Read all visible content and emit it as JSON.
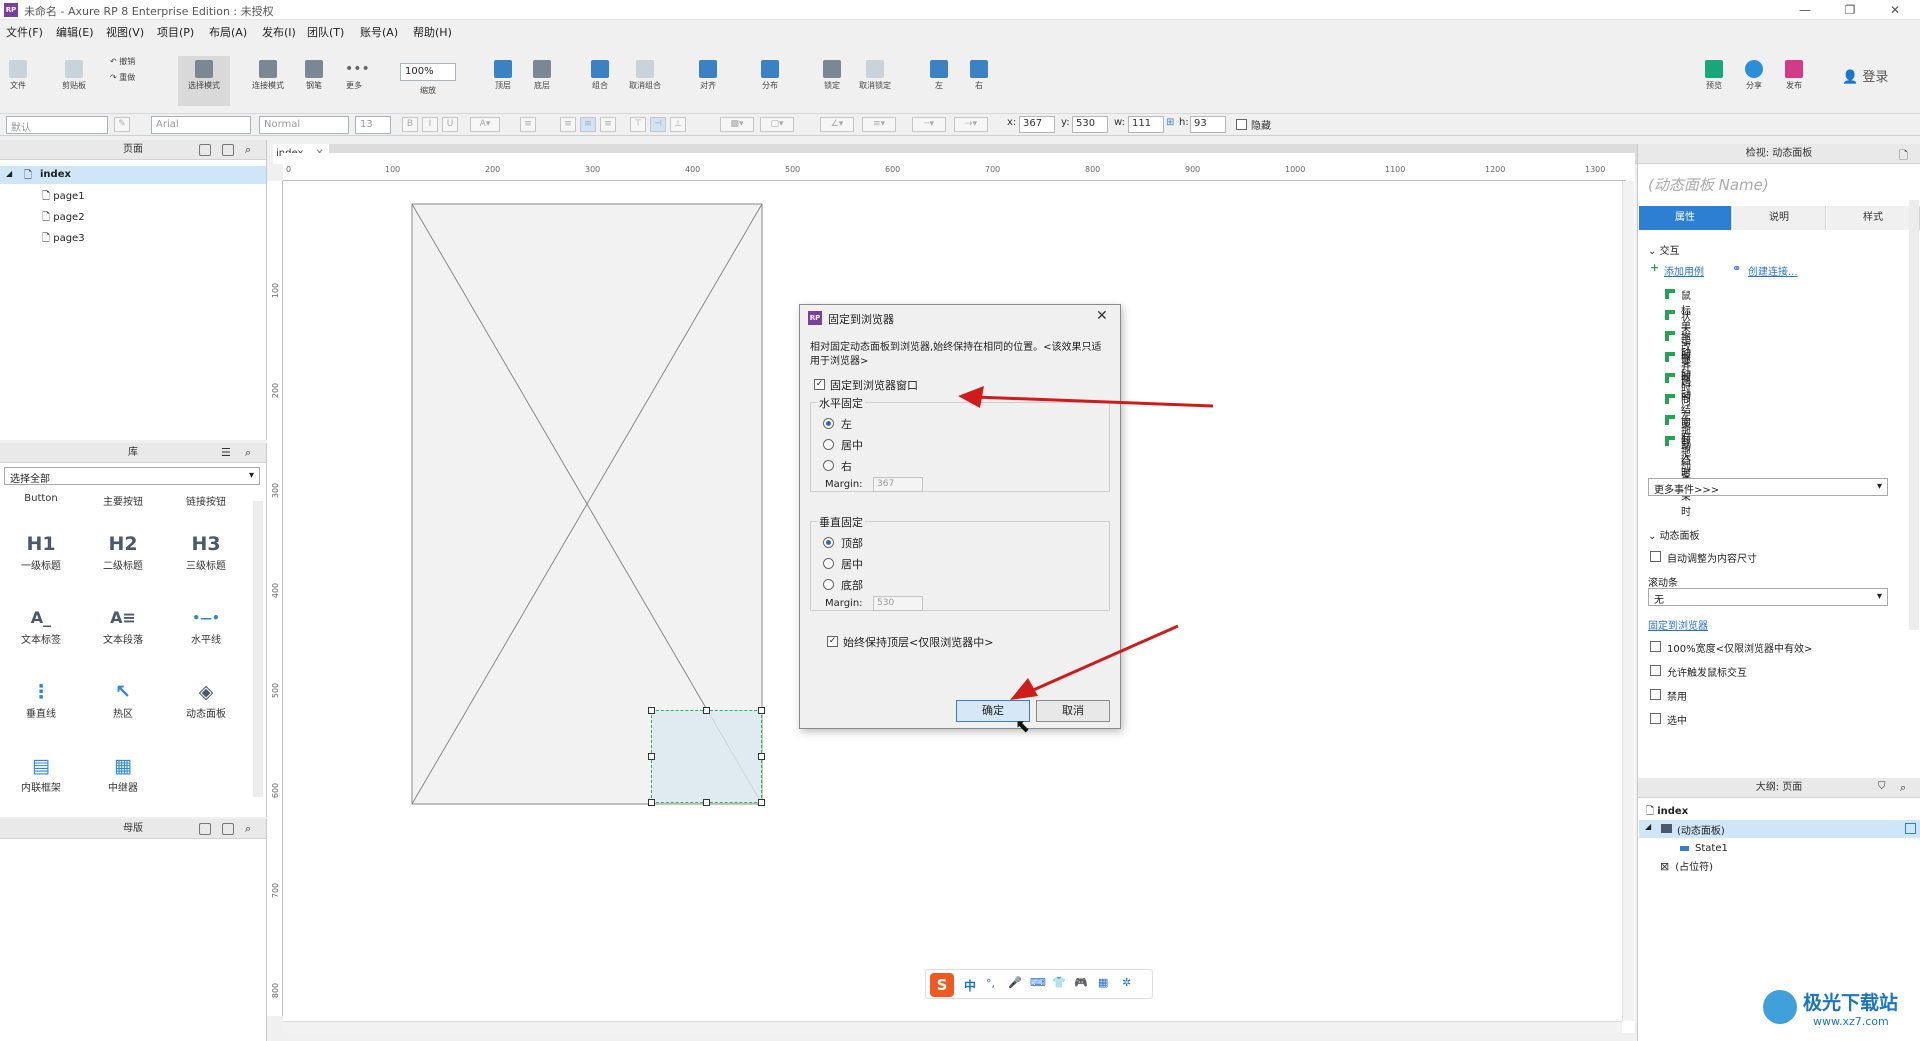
{
  "window": {
    "title": "未命名 - Axure RP 8 Enterprise Edition : 未授权",
    "logo_text": "RP",
    "controls": [
      "—",
      "❐",
      "✕"
    ]
  },
  "menu": [
    "文件(F)",
    "编辑(E)",
    "视图(V)",
    "项目(P)",
    "布局(A)",
    "发布(I)",
    "团队(T)",
    "账号(A)",
    "帮助(H)"
  ],
  "toolbar": {
    "file": "文件",
    "clipboard": "剪贴板",
    "undo": "撤销",
    "redo": "重做",
    "select_mode": "选择模式",
    "connect_mode": "连接模式",
    "pen": "钢笔",
    "more": "更多",
    "zoom_value": "100%",
    "zoom_label": "缩放",
    "top": "顶层",
    "bottom": "底层",
    "group": "组合",
    "ungroup": "取消组合",
    "align": "对齐",
    "distribute": "分布",
    "lock": "锁定",
    "unlock": "取消锁定",
    "left": "左",
    "right": "右",
    "preview": "预览",
    "share": "分享",
    "publish": "发布",
    "login": "登录"
  },
  "format_bar": {
    "style": "默认",
    "font": "Arial",
    "weight": "Normal",
    "size": "13",
    "x_label": "x:",
    "x": "367",
    "y_label": "y:",
    "y": "530",
    "w_label": "w:",
    "w": "111",
    "h_label": "h:",
    "h": "93",
    "hidden": "隐藏"
  },
  "pages_panel": {
    "title": "页面",
    "root": "index",
    "pages": [
      "page1",
      "page2",
      "page3"
    ]
  },
  "library_panel": {
    "title": "库",
    "filter": "选择全部",
    "row0": [
      "Button",
      "主要按钮",
      "链接按钮"
    ],
    "items": [
      {
        "glyph": "H1",
        "label": "一级标题"
      },
      {
        "glyph": "H2",
        "label": "二级标题"
      },
      {
        "glyph": "H3",
        "label": "三级标题"
      },
      {
        "glyph": "A_",
        "label": "文本标签"
      },
      {
        "glyph": "A≡",
        "label": "文本段落"
      },
      {
        "glyph": "•—•",
        "label": "水平线"
      },
      {
        "glyph": "⋮",
        "label": "垂直线"
      },
      {
        "glyph": "↖",
        "label": "热区"
      },
      {
        "glyph": "◈",
        "label": "动态面板"
      },
      {
        "glyph": "▤",
        "label": "内联框架"
      },
      {
        "glyph": "▦",
        "label": "中继器"
      }
    ]
  },
  "master_panel": {
    "title": "母版"
  },
  "canvas": {
    "tab": "index",
    "ruler_h": [
      "0",
      "100",
      "200",
      "300",
      "400",
      "500",
      "600",
      "700",
      "800",
      "900",
      "1000",
      "1100",
      "1200",
      "1300"
    ],
    "ruler_v": [
      "100",
      "200",
      "300",
      "400",
      "500",
      "600",
      "700",
      "800"
    ]
  },
  "dialog": {
    "title": "固定到浏览器",
    "logo": "RP",
    "description": "相对固定动态面板到浏览器,始终保持在相同的位置。<该效果只适用于浏览器>",
    "pin_checkbox": "固定到浏览器窗口",
    "pin_checked": true,
    "horizontal": {
      "legend": "水平固定",
      "options": [
        "左",
        "居中",
        "右"
      ],
      "selected": "左",
      "margin_label": "Margin:",
      "margin": "367"
    },
    "vertical": {
      "legend": "垂直固定",
      "options": [
        "顶部",
        "居中",
        "底部"
      ],
      "selected": "顶部",
      "margin_label": "Margin:",
      "margin": "530"
    },
    "always_top": "始终保持顶层<仅限浏览器中>",
    "always_top_checked": true,
    "ok": "确定",
    "cancel": "取消"
  },
  "inspector": {
    "header": "检视: 动态面板",
    "name_placeholder": "(动态面板 Name)",
    "tabs": [
      "属性",
      "说明",
      "样式"
    ],
    "active_tab": "属性",
    "interaction_title": "交互",
    "add_case": "添加用例",
    "create_link": "创建连接...",
    "events": [
      "鼠标单击时",
      "状态改变时",
      "拖动开始时",
      "拖动时",
      "拖动结束时",
      "向左拖动结束时",
      "向右拖动结束时",
      "载入时"
    ],
    "more_events": "更多事件>>>",
    "dp_title": "动态面板",
    "auto_fit": "自动调整为内容尺寸",
    "scrollbar_label": "滚动条",
    "scrollbar_value": "无",
    "pin_link": "固定到浏览器",
    "options": [
      "100%宽度<仅限浏览器中有效>",
      "允许触发鼠标交互",
      "禁用",
      "选中"
    ]
  },
  "outline": {
    "header": "大纲: 页面",
    "root": "index",
    "items": [
      "(动态面板)",
      "State1",
      "(占位符)"
    ]
  },
  "ime_bar": [
    "S",
    "中",
    "°,",
    "🎤",
    "⌨",
    "👕",
    "🎮",
    "▦",
    "✲"
  ],
  "watermark": {
    "brand": "极光下载站",
    "url": "www.xz7.com"
  },
  "colors": {
    "accent": "#2d7fd3",
    "red_arrow": "#d01b1b",
    "selection": "#2db84f"
  }
}
